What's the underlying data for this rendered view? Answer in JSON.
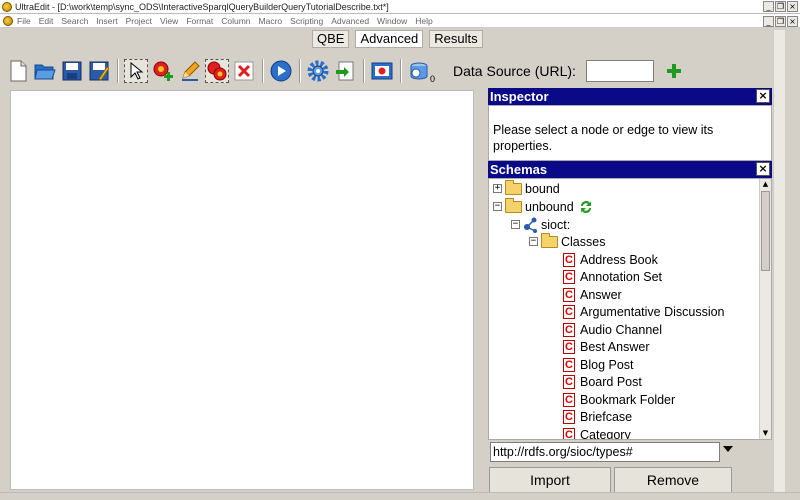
{
  "window": {
    "title": "UltraEdit - [D:\\work\\temp\\sync_ODS\\InteractiveSparqlQueryBuilderQueryTutorialDescribe.txt*]",
    "buttons": [
      "_",
      "❐",
      "×"
    ]
  },
  "menubar": {
    "items": [
      "File",
      "Edit",
      "Search",
      "Insert",
      "Project",
      "View",
      "Format",
      "Column",
      "Macro",
      "Scripting",
      "Advanced",
      "Window",
      "Help"
    ]
  },
  "tabs": [
    {
      "label": "QBE",
      "active": false
    },
    {
      "label": "Advanced",
      "active": true
    },
    {
      "label": "Results",
      "active": false
    }
  ],
  "toolbar": {
    "icons": [
      "new-file-icon",
      "open-folder-icon",
      "save-icon",
      "save-as-icon",
      "select-pointer-icon",
      "add-node-icon",
      "edit-pencil-icon",
      "group-nodes-icon",
      "delete-icon",
      "run-icon",
      "settings-gear-icon",
      "export-icon",
      "print-icon",
      "data-source-icon"
    ],
    "badge": "0",
    "data_source_label": "Data Source (URL):",
    "data_source_value": ""
  },
  "inspector": {
    "title": "Inspector",
    "message": "Please select a node or edge to view its properties."
  },
  "schemas": {
    "title": "Schemas",
    "tree": [
      {
        "label": "bound",
        "toggle": "+",
        "icon": "folder"
      },
      {
        "label": "unbound",
        "toggle": "−",
        "icon": "folder"
      },
      {
        "label": "sioct:",
        "toggle": "−",
        "icon": "namespace"
      },
      {
        "label": "Classes",
        "toggle": "−",
        "icon": "folder"
      },
      {
        "label": "Address Book",
        "icon": "class"
      },
      {
        "label": "Annotation Set",
        "icon": "class"
      },
      {
        "label": "Answer",
        "icon": "class"
      },
      {
        "label": "Argumentative Discussion",
        "icon": "class"
      },
      {
        "label": "Audio Channel",
        "icon": "class"
      },
      {
        "label": "Best Answer",
        "icon": "class"
      },
      {
        "label": "Blog Post",
        "icon": "class"
      },
      {
        "label": "Board Post",
        "icon": "class"
      },
      {
        "label": "Bookmark Folder",
        "icon": "class"
      },
      {
        "label": "Briefcase",
        "icon": "class"
      },
      {
        "label": "Category",
        "icon": "class"
      }
    ],
    "url_value": "http://rdfs.org/sioc/types#",
    "import_label": "Import",
    "remove_label": "Remove"
  },
  "colors": {
    "panel_header": "#0a0a88",
    "class_icon": "#d00000",
    "add_green": "#1f9a1f"
  }
}
